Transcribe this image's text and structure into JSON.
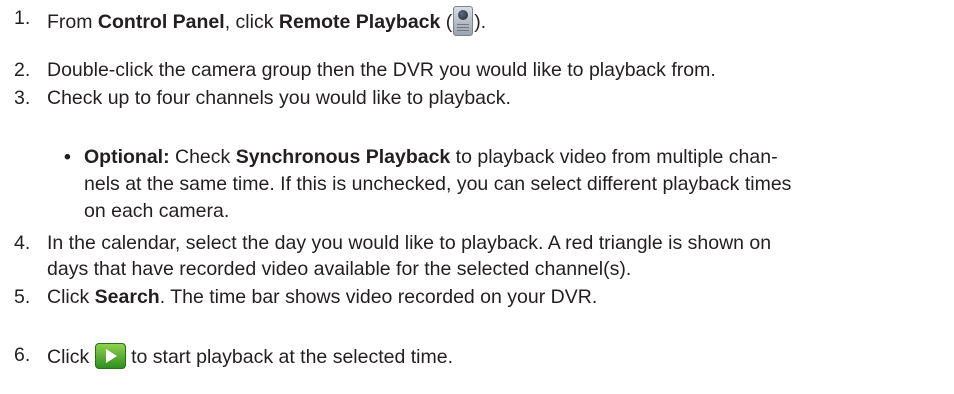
{
  "steps": [
    {
      "number": "1.",
      "parts": [
        "From ",
        "Control Panel",
        ", click ",
        "Remote Playback",
        " (",
        ")."
      ],
      "icon": "remote-playback-icon"
    },
    {
      "number": "2.",
      "text": "Double-click the camera group then the DVR you would like to playback from."
    },
    {
      "number": "3.",
      "text": "Check up to four channels you would like to playback."
    },
    {
      "number": "4.",
      "lines": [
        "In the calendar, select the day you would like to playback. A red triangle is shown on",
        "days that have recorded video available for the selected channel(s)."
      ]
    },
    {
      "number": "5.",
      "parts": [
        "Click ",
        "Search",
        ". The time bar shows video recorded on your DVR."
      ]
    },
    {
      "number": "6.",
      "parts": [
        "Click ",
        " to start playback at the selected time."
      ],
      "icon": "play-icon"
    }
  ],
  "optional_note": {
    "bullet": "•",
    "label": "Optional:",
    "line1": [
      " Check ",
      "Synchronous Playback",
      " to playback video from multiple chan-"
    ],
    "line2": "nels at the same time. If this is unchecked, you can select different playback times",
    "line3": "on each camera."
  }
}
